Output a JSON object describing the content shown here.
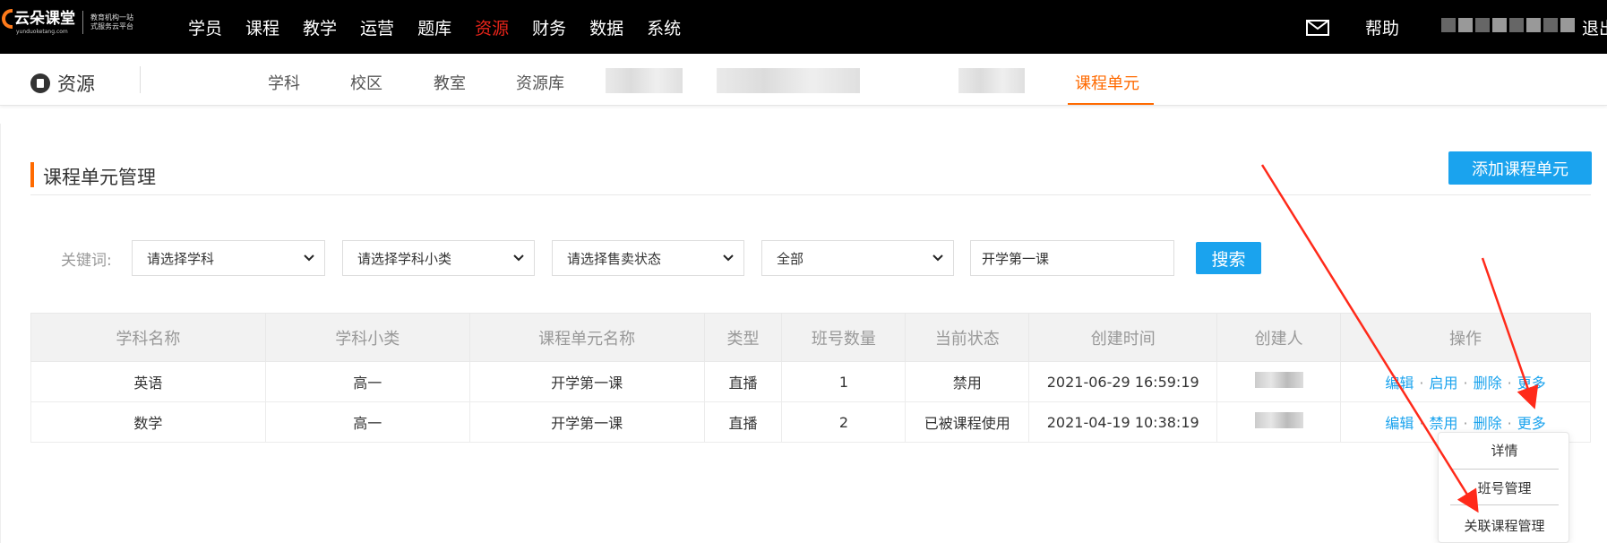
{
  "topbar": {
    "logo": {
      "main": "云朵课堂",
      "url": "yunduoketang.com",
      "slogan_line1": "教育机构一站",
      "slogan_line2": "式服务云平台"
    },
    "nav": [
      {
        "label": "学员",
        "active": false
      },
      {
        "label": "课程",
        "active": false
      },
      {
        "label": "教学",
        "active": false
      },
      {
        "label": "运营",
        "active": false
      },
      {
        "label": "题库",
        "active": false
      },
      {
        "label": "资源",
        "active": true
      },
      {
        "label": "财务",
        "active": false
      },
      {
        "label": "数据",
        "active": false
      },
      {
        "label": "系统",
        "active": false
      }
    ],
    "mail_icon": "mail-icon",
    "help_label": "帮助",
    "logout_label": "退出"
  },
  "subnav": {
    "section_title": "资源",
    "section_icon": "resource-icon",
    "items": [
      {
        "label": "学科",
        "active": false
      },
      {
        "label": "校区",
        "active": false
      },
      {
        "label": "教室",
        "active": false
      },
      {
        "label": "资源库",
        "active": false
      },
      {
        "label": "课程单元",
        "active": true
      }
    ]
  },
  "page": {
    "title": "课程单元管理",
    "add_button": "添加课程单元"
  },
  "filters": {
    "keyword_label": "关键词:",
    "subject_select": "请选择学科",
    "subcategory_select": "请选择学科小类",
    "sale_status_select": "请选择售卖状态",
    "all_select": "全部",
    "keyword_value": "开学第一课",
    "search_button": "搜索"
  },
  "table": {
    "headers": [
      "学科名称",
      "学科小类",
      "课程单元名称",
      "类型",
      "班号数量",
      "当前状态",
      "创建时间",
      "创建人",
      "操作"
    ],
    "rows": [
      {
        "subject": "英语",
        "subcategory": "高一",
        "unit_name": "开学第一课",
        "type": "直播",
        "class_count": "1",
        "status": "禁用",
        "created_at": "2021-06-29 16:59:19",
        "ops": [
          "编辑",
          "启用",
          "删除",
          "更多"
        ]
      },
      {
        "subject": "数学",
        "subcategory": "高一",
        "unit_name": "开学第一课",
        "type": "直播",
        "class_count": "2",
        "status": "已被课程使用",
        "created_at": "2021-04-19 10:38:19",
        "ops": [
          "编辑",
          "禁用",
          "删除",
          "更多"
        ]
      }
    ],
    "op_separator": "·"
  },
  "more_menu": {
    "items": [
      "详情",
      "班号管理",
      "关联课程管理"
    ]
  },
  "colors": {
    "accent_orange": "#ff6a00",
    "primary_blue": "#1aa3ee",
    "active_red": "#e8241a",
    "annotation_arrow": "#ff2a1a"
  }
}
